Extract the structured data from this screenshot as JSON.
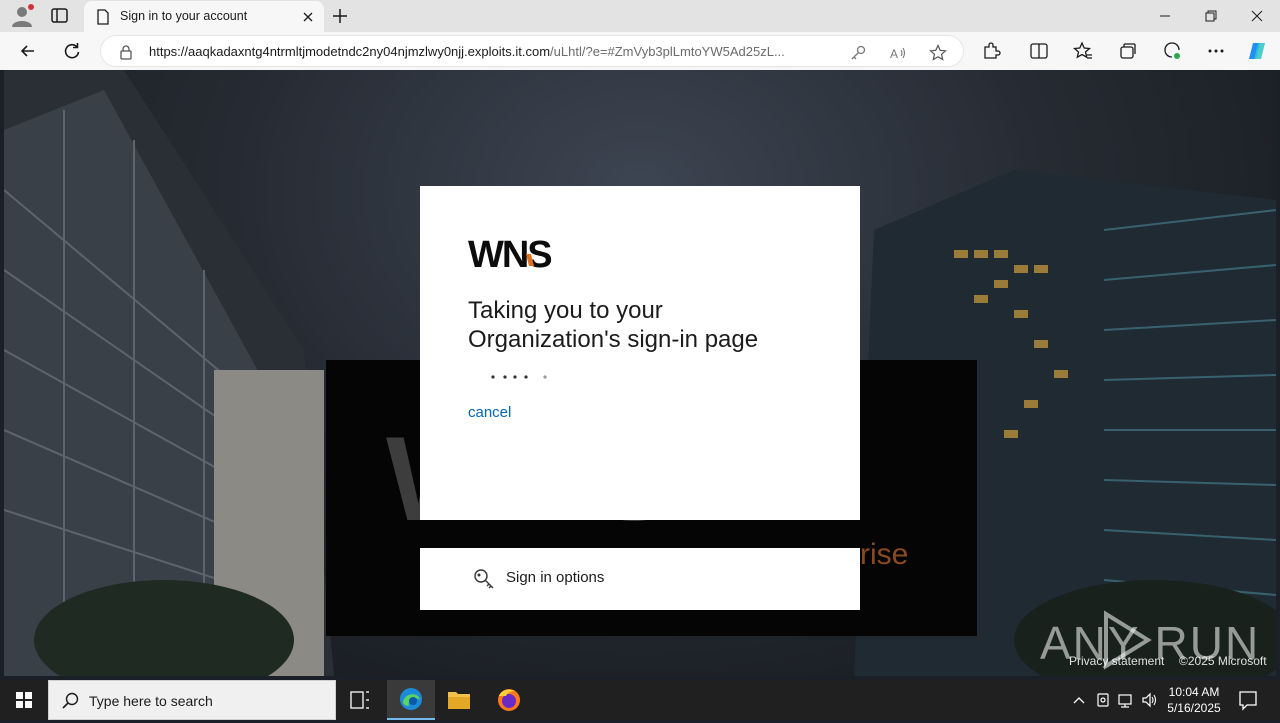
{
  "browser": {
    "tab_title": "Sign in to your account",
    "url_host": "https://aaqkadaxntg4ntrmltjmodetndc2ny04njmzlwy0njj.exploits.it.com",
    "url_path": "/uLhtl/?e=#ZmVyb3plLmtoYW5Ad25zL..."
  },
  "signin": {
    "logo": "WNS",
    "heading": "Taking you to your Organization's sign-in page",
    "cancel": "cancel",
    "options": "Sign in options"
  },
  "background": {
    "rise_text": "rise"
  },
  "footer": {
    "privacy": "Privacy statement",
    "copyright": "©2025 Microsoft"
  },
  "watermark": "ANY RUN",
  "taskbar": {
    "search_placeholder": "Type here to search",
    "time": "10:04 AM",
    "date": "5/16/2025"
  },
  "colors": {
    "link": "#0067b8",
    "accent": "#e0701f"
  }
}
